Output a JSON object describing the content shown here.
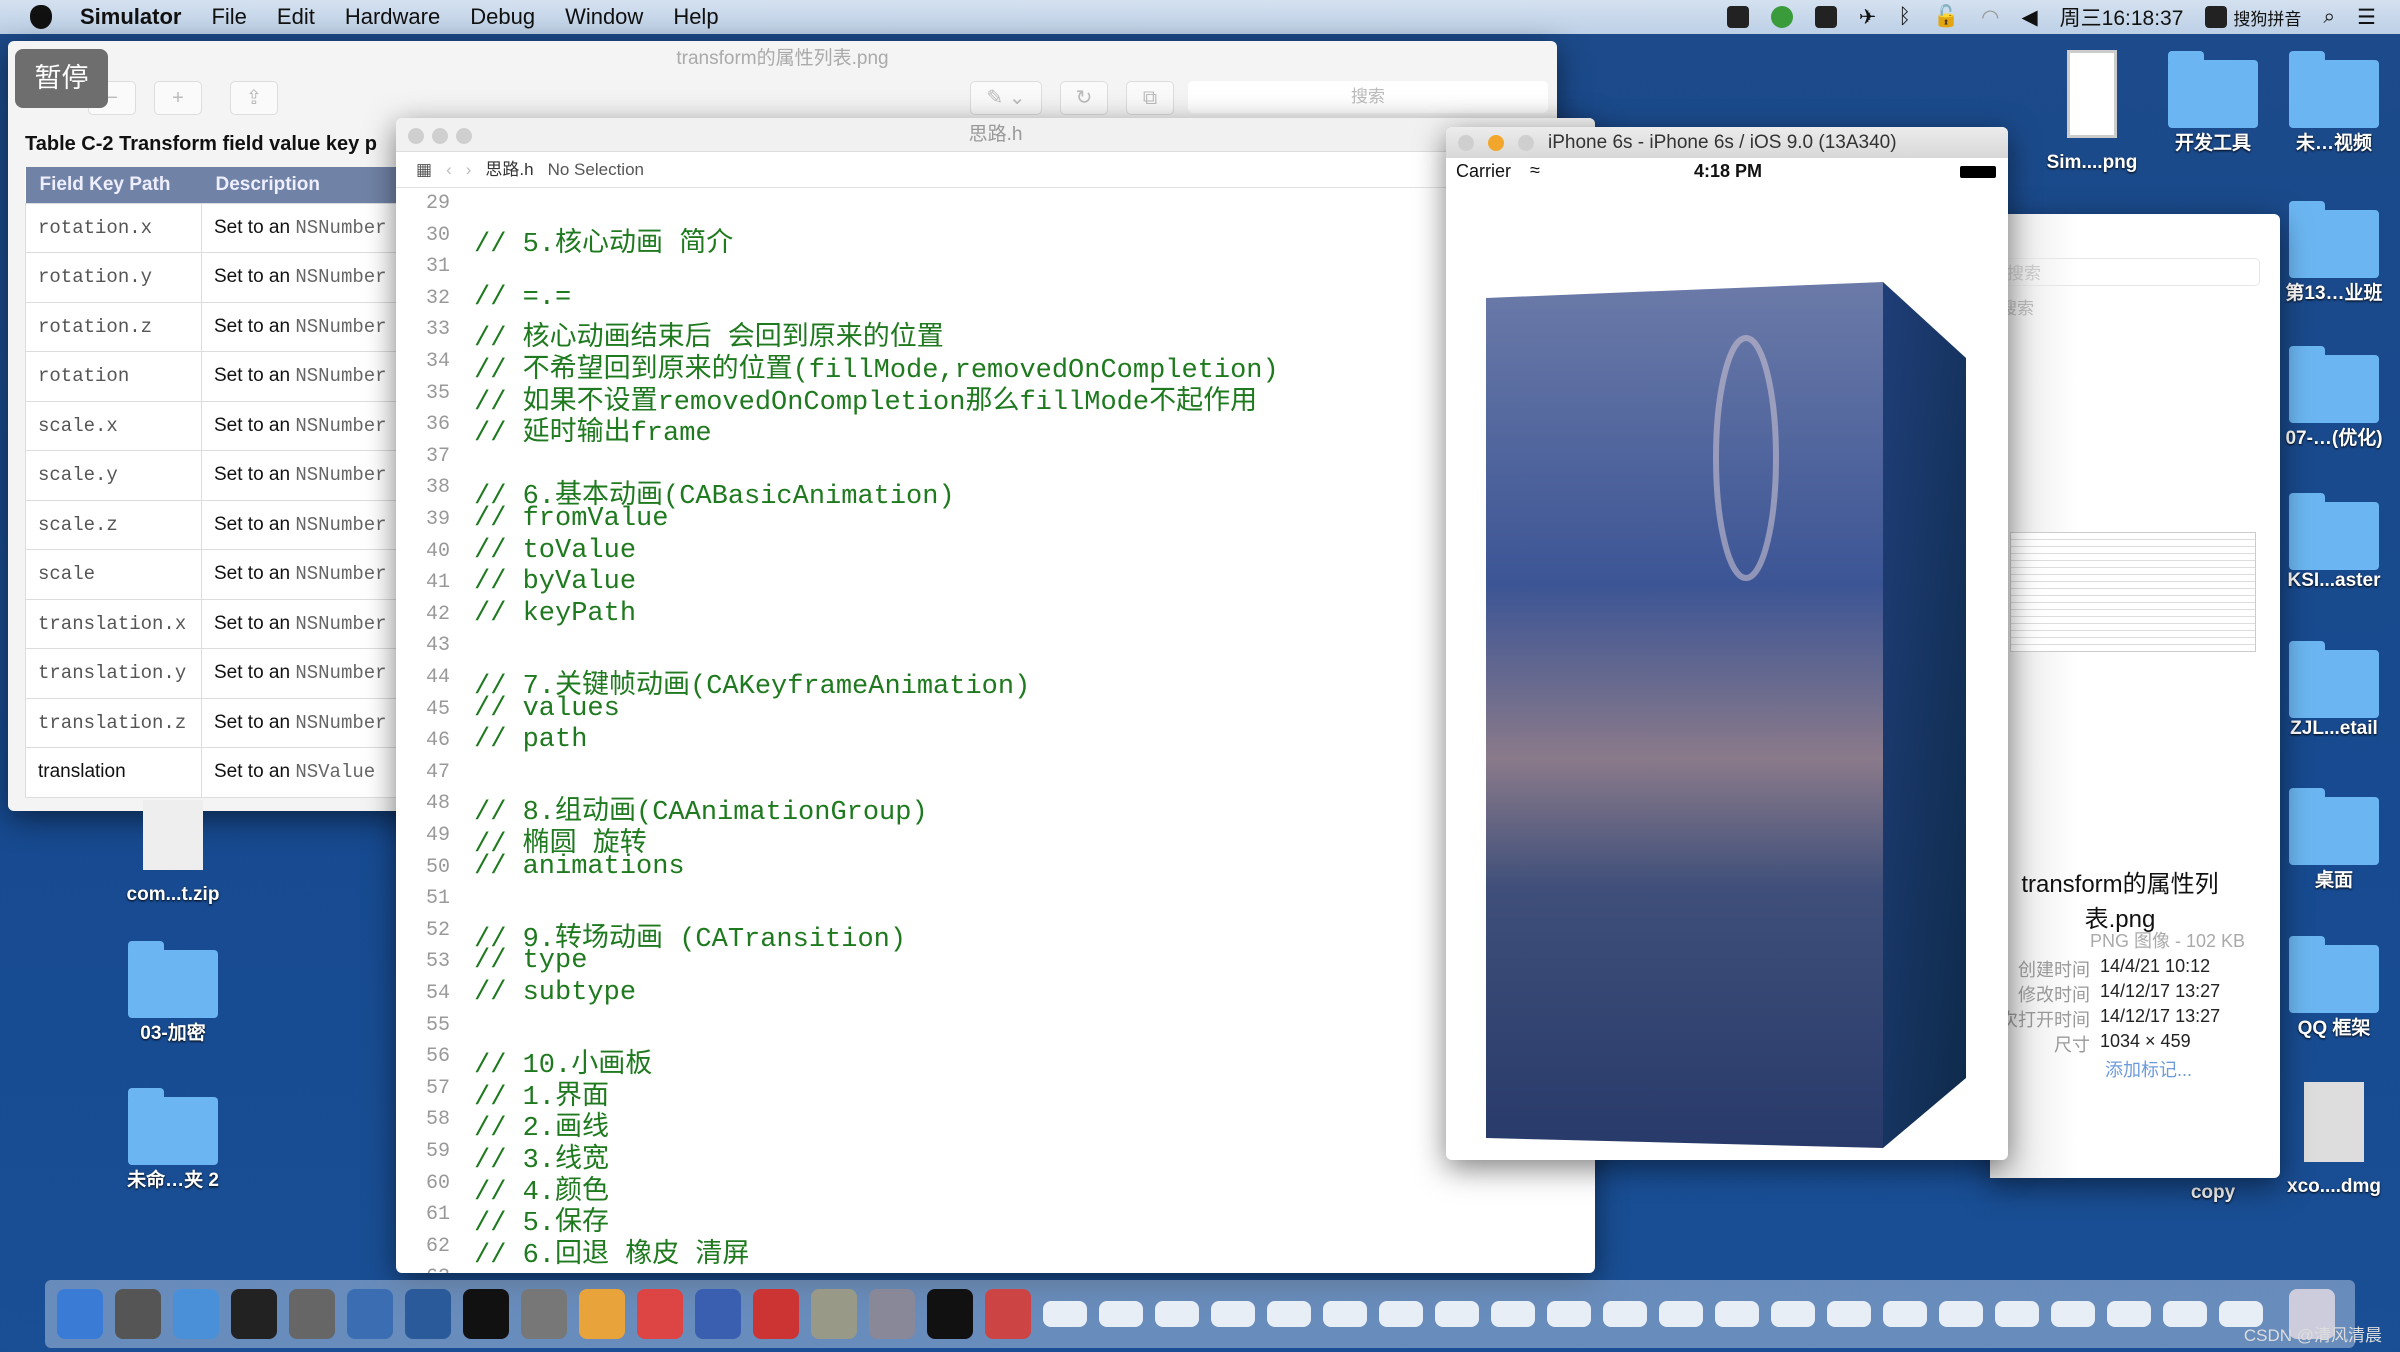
{
  "menubar": {
    "app": "Simulator",
    "items": [
      "File",
      "Edit",
      "Hardware",
      "Debug",
      "Window",
      "Help"
    ],
    "clock": "周三16:18:37",
    "ime": "搜狗拼音"
  },
  "pause_label": "暂停",
  "preview": {
    "title": "transform的属性列表.png",
    "search_placeholder": "搜索",
    "table_caption": "Table C-2  Transform field value key p",
    "headers": [
      "Field Key Path",
      "Description"
    ],
    "rows": [
      [
        "rotation.x",
        "Set to an ",
        "NSNumber"
      ],
      [
        "rotation.y",
        "Set to an ",
        "NSNumber"
      ],
      [
        "rotation.z",
        "Set to an ",
        "NSNumber"
      ],
      [
        "rotation",
        "Set to an ",
        "NSNumber"
      ],
      [
        "scale.x",
        "Set to an ",
        "NSNumber"
      ],
      [
        "scale.y",
        "Set to an ",
        "NSNumber"
      ],
      [
        "scale.z",
        "Set to an ",
        "NSNumber"
      ],
      [
        "scale",
        "Set to an ",
        "NSNumber"
      ],
      [
        "translation.x",
        "Set to an ",
        "NSNumber"
      ],
      [
        "translation.y",
        "Set to an ",
        "NSNumber"
      ],
      [
        "translation.z",
        "Set to an ",
        "NSNumber"
      ],
      [
        "translation",
        "Set to an ",
        "NSValue"
      ]
    ]
  },
  "xcode": {
    "title": "思路.h",
    "breadcrumb_file": "思路.h",
    "breadcrumb_sel": "No Selection",
    "first_line": 29,
    "lines": [
      "",
      "// 5.核心动画 简介",
      "",
      "// =.=",
      "// 核心动画结束后 会回到原来的位置",
      "// 不希望回到原来的位置(fillMode,removedOnCompletion)",
      "// 如果不设置removedOnCompletion那么fillMode不起作用",
      "// 延时输出frame",
      "",
      "// 6.基本动画(CABasicAnimation)",
      "// fromValue",
      "// toValue",
      "// byValue",
      "// keyPath",
      "",
      "// 7.关键帧动画(CAKeyframeAnimation)",
      "// values",
      "// path",
      "",
      "// 8.组动画(CAAnimationGroup)",
      "// 椭圆 旋转",
      "// animations",
      "",
      "// 9.转场动画 (CATransition)",
      "// type",
      "// subtype",
      "",
      "// 10.小画板",
      "// 1.界面",
      "// 2.画线",
      "// 3.线宽",
      "// 4.颜色",
      "// 5.保存",
      "// 6.回退 橡皮 清屏",
      ""
    ]
  },
  "simulator": {
    "title": "iPhone 6s - iPhone 6s / iOS 9.0 (13A340)",
    "carrier": "Carrier",
    "time": "4:18 PM"
  },
  "finder_info": {
    "search_placeholder": "搜索",
    "search_label": "搜索",
    "name": "transform的属性列表.png",
    "kind": "PNG 图像 - 102 KB",
    "rows": [
      [
        "创建时间",
        "14/4/21 10:12"
      ],
      [
        "修改时间",
        "14/12/17 13:27"
      ],
      [
        "上次打开时间",
        "14/12/17 13:27"
      ],
      [
        "尺寸",
        "1034 × 459"
      ]
    ],
    "add_tag": "添加标记..."
  },
  "desktop": {
    "left": [
      "com...t.zip",
      "03-加密",
      "未命…夹 2"
    ],
    "top": [
      "Sim....png",
      "开发工具",
      "未…视频"
    ],
    "right": [
      "第13…业班",
      "07-…(优化)",
      "KSI...aster",
      "ZJL...etail",
      "桌面",
      "QQ 框架",
      "xco....dmg"
    ],
    "copy": "copy"
  },
  "colors": {
    "code_comment": "#1f7a1f",
    "desktop": "#1a4a8c",
    "table_header": "#7083a6"
  },
  "watermark": "CSDN @清风清晨"
}
